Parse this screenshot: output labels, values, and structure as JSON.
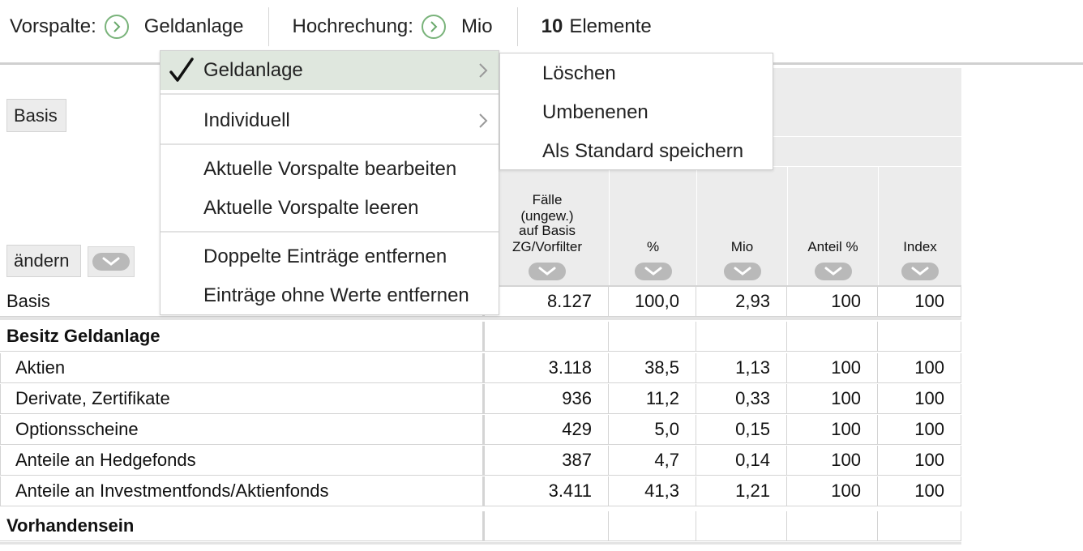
{
  "toolbar": {
    "vorspalte_label": "Vorspalte:",
    "vorspalte_value": "Geldanlage",
    "hochrechnung_label": "Hochrechung:",
    "hochrechnung_value": "Mio",
    "elements_count": "10",
    "elements_label": "Elemente",
    "icon": "circle-chevron-right-icon"
  },
  "left": {
    "basis_button": "Basis",
    "aendern_button": "ändern"
  },
  "columns": [
    {
      "label": "Fälle (ungew.) auf Basis ZG/Vorfilter",
      "lines": [
        "Fälle",
        "(ungew.)",
        "auf Basis",
        "ZG/Vorfilter"
      ]
    },
    {
      "label": "%",
      "lines": [
        "%"
      ]
    },
    {
      "label": "Mio",
      "lines": [
        "Mio"
      ]
    },
    {
      "label": "Anteil %",
      "lines": [
        "Anteil %"
      ]
    },
    {
      "label": "Index",
      "lines": [
        "Index"
      ]
    }
  ],
  "table": {
    "rows": [
      {
        "type": "data",
        "indent": false,
        "label": "Basis",
        "values": [
          "8.127",
          "100,0",
          "2,93",
          "100",
          "100"
        ]
      },
      {
        "type": "section",
        "label": "Besitz Geldanlage",
        "values": [
          "",
          "",
          "",
          "",
          ""
        ]
      },
      {
        "type": "data",
        "indent": true,
        "label": "Aktien",
        "values": [
          "3.118",
          "38,5",
          "1,13",
          "100",
          "100"
        ]
      },
      {
        "type": "data",
        "indent": true,
        "label": "Derivate, Zertifikate",
        "values": [
          "936",
          "11,2",
          "0,33",
          "100",
          "100"
        ]
      },
      {
        "type": "data",
        "indent": true,
        "label": "Optionsscheine",
        "values": [
          "429",
          "5,0",
          "0,15",
          "100",
          "100"
        ]
      },
      {
        "type": "data",
        "indent": true,
        "label": "Anteile an Hedgefonds",
        "values": [
          "387",
          "4,7",
          "0,14",
          "100",
          "100"
        ]
      },
      {
        "type": "data",
        "indent": true,
        "label": "Anteile an Investmentfonds/Aktienfonds",
        "values": [
          "3.411",
          "41,3",
          "1,21",
          "100",
          "100"
        ]
      },
      {
        "type": "section",
        "label": "Vorhandensein",
        "values": [
          "",
          "",
          "",
          "",
          ""
        ]
      }
    ]
  },
  "main_menu": {
    "items": [
      {
        "label": "Geldanlage",
        "selected": true,
        "submenu": true
      },
      {
        "label": "Individuell",
        "selected": false,
        "submenu": true
      },
      {
        "label": "Aktuelle Vorspalte bearbeiten",
        "selected": false,
        "submenu": false
      },
      {
        "label": "Aktuelle Vorspalte leeren",
        "selected": false,
        "submenu": false
      },
      {
        "label": "Doppelte Einträge entfernen",
        "selected": false,
        "submenu": false
      },
      {
        "label": "Einträge ohne Werte entfernen",
        "selected": false,
        "submenu": false
      }
    ]
  },
  "sub_menu": {
    "items": [
      {
        "label": "Löschen"
      },
      {
        "label": "Umbenenen"
      },
      {
        "label": "Als Standard speichern"
      }
    ]
  },
  "colors": {
    "accent_green": "#6aa96c",
    "selected_bg": "#dfe7de",
    "header_bg": "#ececec",
    "border": "#d4d4d4"
  }
}
